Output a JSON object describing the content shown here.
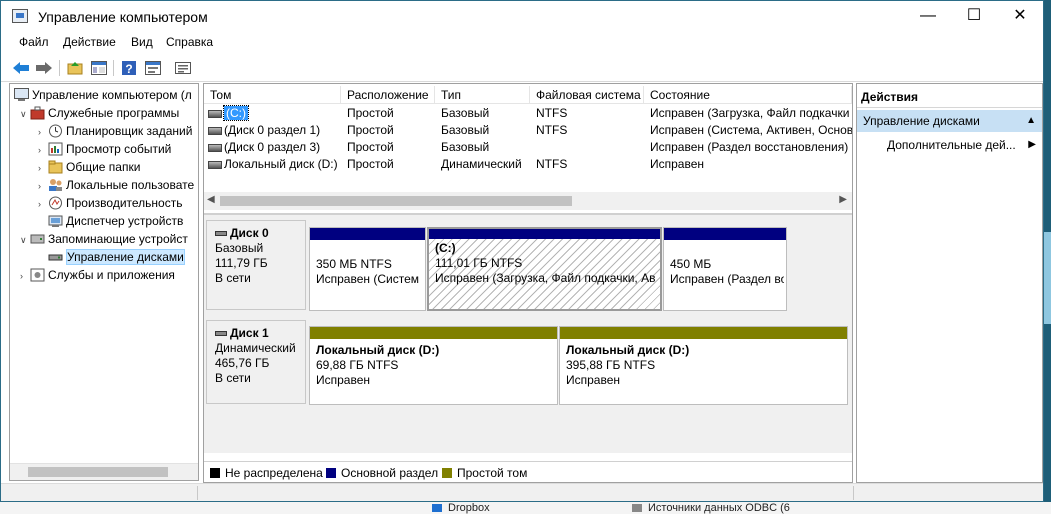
{
  "window": {
    "title": "Управление компьютером",
    "minimize_glyph": "—",
    "maximize_glyph": "☐",
    "close_glyph": "✕"
  },
  "menu": {
    "file": "Файл",
    "action": "Действие",
    "view": "Вид",
    "help": "Справка"
  },
  "toolbar": {
    "icons": [
      "back-icon",
      "forward-icon",
      "up-folder-icon",
      "show-hide-tree-icon",
      "help-icon",
      "properties-icon",
      "export-list-icon"
    ]
  },
  "tree": {
    "root": "Управление компьютером (л",
    "system_tools": "Служебные программы",
    "task_scheduler": "Планировщик заданий",
    "event_viewer": "Просмотр событий",
    "shared_folders": "Общие папки",
    "local_users": "Локальные пользовате",
    "performance": "Производительность",
    "device_manager": "Диспетчер устройств",
    "storage": "Запоминающие устройст",
    "disk_management": "Управление дисками",
    "services_apps": "Службы и приложения"
  },
  "volume_list": {
    "columns": [
      "Том",
      "Расположение",
      "Тип",
      "Файловая система",
      "Состояние"
    ],
    "rows": [
      {
        "volume": "(C:)",
        "layout": "Простой",
        "type": "Базовый",
        "fs": "NTFS",
        "status": "Исправен (Загрузка, Файл подкачки"
      },
      {
        "volume": "(Диск 0 раздел 1)",
        "layout": "Простой",
        "type": "Базовый",
        "fs": "NTFS",
        "status": "Исправен (Система, Активен, Основ"
      },
      {
        "volume": "(Диск 0 раздел 3)",
        "layout": "Простой",
        "type": "Базовый",
        "fs": "",
        "status": "Исправен (Раздел восстановления)"
      },
      {
        "volume": "Локальный диск (D:)",
        "layout": "Простой",
        "type": "Динамический",
        "fs": "NTFS",
        "status": "Исправен"
      }
    ]
  },
  "disks": [
    {
      "name": "Диск 0",
      "kind": "Базовый",
      "size": "111,79 ГБ",
      "state": "В сети",
      "partitions": [
        {
          "label": "",
          "size_fs": "350 МБ NTFS",
          "status": "Исправен (Систем"
        },
        {
          "label": "(C:)",
          "size_fs": "111,01 ГБ NTFS",
          "status": "Исправен (Загрузка, Файл подкачки, Ав"
        },
        {
          "label": "",
          "size_fs": "450 МБ",
          "status": "Исправен (Раздел во"
        }
      ]
    },
    {
      "name": "Диск 1",
      "kind": "Динамический",
      "size": "465,76 ГБ",
      "state": "В сети",
      "partitions": [
        {
          "label": "Локальный диск  (D:)",
          "size_fs": "69,88 ГБ NTFS",
          "status": "Исправен"
        },
        {
          "label": "Локальный диск  (D:)",
          "size_fs": "395,88 ГБ NTFS",
          "status": "Исправен"
        }
      ]
    }
  ],
  "legend": {
    "unallocated": "Не распределена",
    "primary": "Основной раздел",
    "simple": "Простой том"
  },
  "colors": {
    "unallocated": "#000000",
    "primary": "#000080",
    "simple": "#808000",
    "selection": "#cce8ff",
    "actions_header": "#c7e0f4"
  },
  "actions": {
    "title": "Действия",
    "section": "Управление дисками",
    "more": "Дополнительные дей..."
  },
  "background": {
    "dropbox": "Dropbox",
    "odbc": "Источники данных ODBC (6"
  }
}
